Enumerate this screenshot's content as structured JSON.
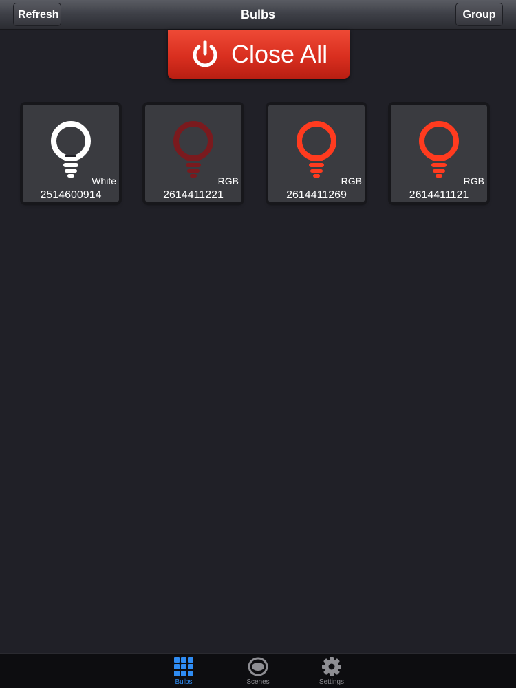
{
  "nav": {
    "title": "Bulbs",
    "left_button": "Refresh",
    "right_button": "Group"
  },
  "close_all": {
    "label": "Close All",
    "icon": "power-icon",
    "color": "#d92f1f"
  },
  "bulbs": [
    {
      "id": "2514600914",
      "type": "White",
      "state": "on",
      "color": "#ffffff"
    },
    {
      "id": "2614411221",
      "type": "RGB",
      "state": "off",
      "color": "#7a1a1e"
    },
    {
      "id": "2614411269",
      "type": "RGB",
      "state": "on",
      "color": "#ff3b1f"
    },
    {
      "id": "2614411121",
      "type": "RGB",
      "state": "on",
      "color": "#ff3b1f"
    }
  ],
  "tabbar": {
    "tabs": [
      {
        "label": "Bulbs",
        "icon": "grid-icon",
        "active": true
      },
      {
        "label": "Scenes",
        "icon": "eye-icon",
        "active": false
      },
      {
        "label": "Settings",
        "icon": "gear-icon",
        "active": false
      }
    ],
    "active_color": "#2f8cf3"
  }
}
